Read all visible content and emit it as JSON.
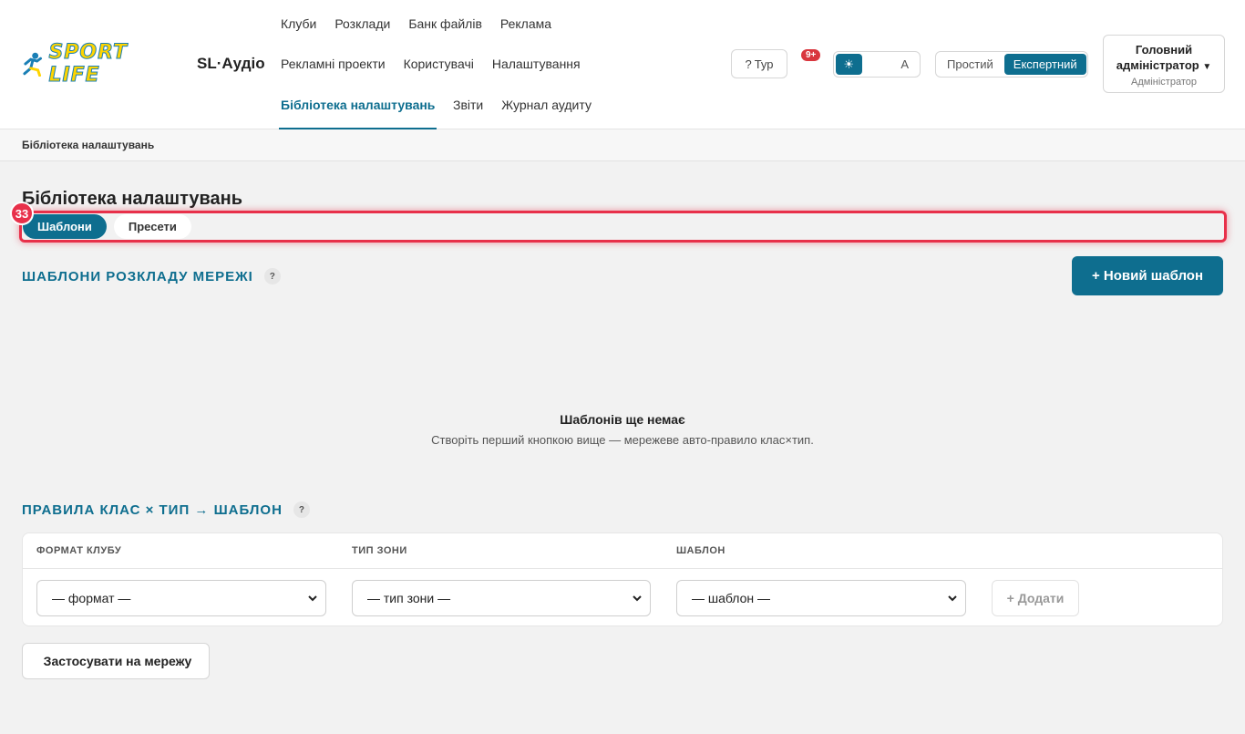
{
  "header": {
    "app_name": "SL·Аудіо",
    "nav_row1": [
      "Клуби",
      "Розклади",
      "Банк файлів",
      "Реклама"
    ],
    "nav_row2": [
      "Рекламні проекти",
      "Користувачі",
      "Налаштування"
    ],
    "nav_active": "Бібліотека налаштувань",
    "nav_row3_rest": [
      "Звіти",
      "Журнал аудиту"
    ],
    "search_glyph": "",
    "tour_label": "Тур",
    "tour_glyph": "?",
    "bell_glyph": "",
    "notif_badge": "9+",
    "theme_options": [
      "☀",
      "",
      "A"
    ],
    "mode_simple": "Простий",
    "mode_expert": "Експертний",
    "user_name": "Головний адміністратор",
    "user_caret": "▼",
    "user_role": "Адміністратор",
    "accent": "#0e6e8f"
  },
  "breadcrumb": "Бібліотека налаштувань",
  "page_title": "Бібліотека налаштувань",
  "tabs": [
    {
      "label": "Шаблони",
      "active": true
    },
    {
      "label": "Пресети",
      "active": false
    }
  ],
  "marker_number": "33",
  "templates_section": {
    "title": "ШАБЛОНИ РОЗКЛАДУ МЕРЕЖІ",
    "help": "?",
    "new_button": "+ Новий шаблон",
    "empty_icon": "",
    "empty_title": "Шаблонів ще немає",
    "empty_subtitle": "Створіть перший кнопкою вище — мережеве авто-правило клас×тип."
  },
  "rules_section": {
    "title": "ПРАВИЛА КЛАС × ТИП → ШАБЛОН",
    "help": "?",
    "columns": [
      "ФОРМАТ КЛУБУ",
      "ТИП ЗОНИ",
      "ШАБЛОН"
    ],
    "format_placeholder": "— формат —",
    "zone_placeholder": "— тип зони —",
    "template_placeholder": "— шаблон —",
    "add_button": "+ Додати"
  },
  "apply_button": "Застосувати на мережу",
  "apply_glyph": ""
}
